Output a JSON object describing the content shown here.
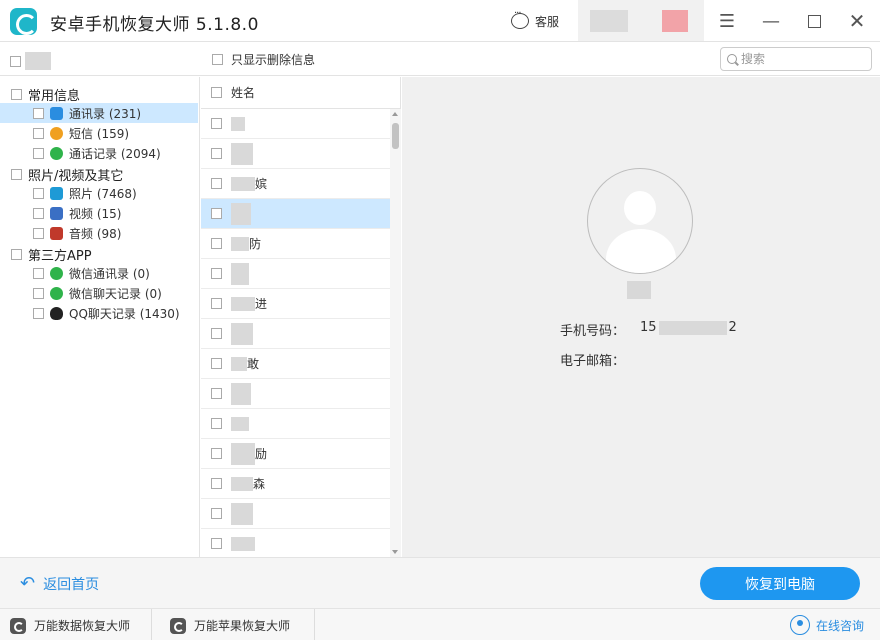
{
  "app": {
    "title": "安卓手机恢复大师 5.1.8.0"
  },
  "titlebar": {
    "service_label": "客服"
  },
  "topbar": {
    "only_deleted_label": "只显示删除信息",
    "search_placeholder": "搜索"
  },
  "categories": [
    {
      "label": "常用信息",
      "items": [
        {
          "label": "通讯录 (231)",
          "icon": "contacts-icon",
          "color": "#2a8de0",
          "selected": true
        },
        {
          "label": "短信 (159)",
          "icon": "sms-icon",
          "color": "#f0a020",
          "selected": false
        },
        {
          "label": "通话记录 (2094)",
          "icon": "phone-icon",
          "color": "#2fb34a",
          "selected": false
        }
      ]
    },
    {
      "label": "照片/视频及其它",
      "items": [
        {
          "label": "照片 (7468)",
          "icon": "photo-icon",
          "color": "#1e9ad6",
          "selected": false
        },
        {
          "label": "视频 (15)",
          "icon": "video-icon",
          "color": "#3a6fc4",
          "selected": false
        },
        {
          "label": "音频 (98)",
          "icon": "audio-icon",
          "color": "#c0392b",
          "selected": false
        }
      ]
    },
    {
      "label": "第三方APP",
      "items": [
        {
          "label": "微信通讯录 (0)",
          "icon": "wechat-icon",
          "color": "#2fb34a",
          "selected": false
        },
        {
          "label": "微信聊天记录 (0)",
          "icon": "wechat-icon",
          "color": "#2fb34a",
          "selected": false
        },
        {
          "label": "QQ聊天记录 (1430)",
          "icon": "qq-icon",
          "color": "#222222",
          "selected": false
        }
      ]
    }
  ],
  "list": {
    "header": "姓名",
    "rows": [
      {
        "text": "",
        "selected": false
      },
      {
        "text": "",
        "selected": false
      },
      {
        "text": "嫔",
        "selected": false
      },
      {
        "text": "",
        "selected": true
      },
      {
        "text": "防",
        "selected": false
      },
      {
        "text": "",
        "selected": false
      },
      {
        "text": "进",
        "selected": false
      },
      {
        "text": "",
        "selected": false
      },
      {
        "text": "敢",
        "selected": false
      },
      {
        "text": "",
        "selected": false
      },
      {
        "text": "",
        "selected": false
      },
      {
        "text": "励",
        "selected": false
      },
      {
        "text": "森",
        "selected": false
      },
      {
        "text": "",
        "selected": false
      },
      {
        "text": "",
        "selected": false
      }
    ]
  },
  "detail": {
    "phone_label": "手机号码：",
    "phone_prefix": "15",
    "phone_suffix": "2",
    "email_label": "电子邮箱："
  },
  "bottom": {
    "back_label": "返回首页",
    "recover_label": "恢复到电脑"
  },
  "footer": {
    "item1": "万能数据恢复大师",
    "item2": "万能苹果恢复大师",
    "consult": "在线咨询"
  },
  "colors": {
    "accent": "#1e97f0",
    "selection": "#cde8ff",
    "logo": "#1fb6c9"
  }
}
